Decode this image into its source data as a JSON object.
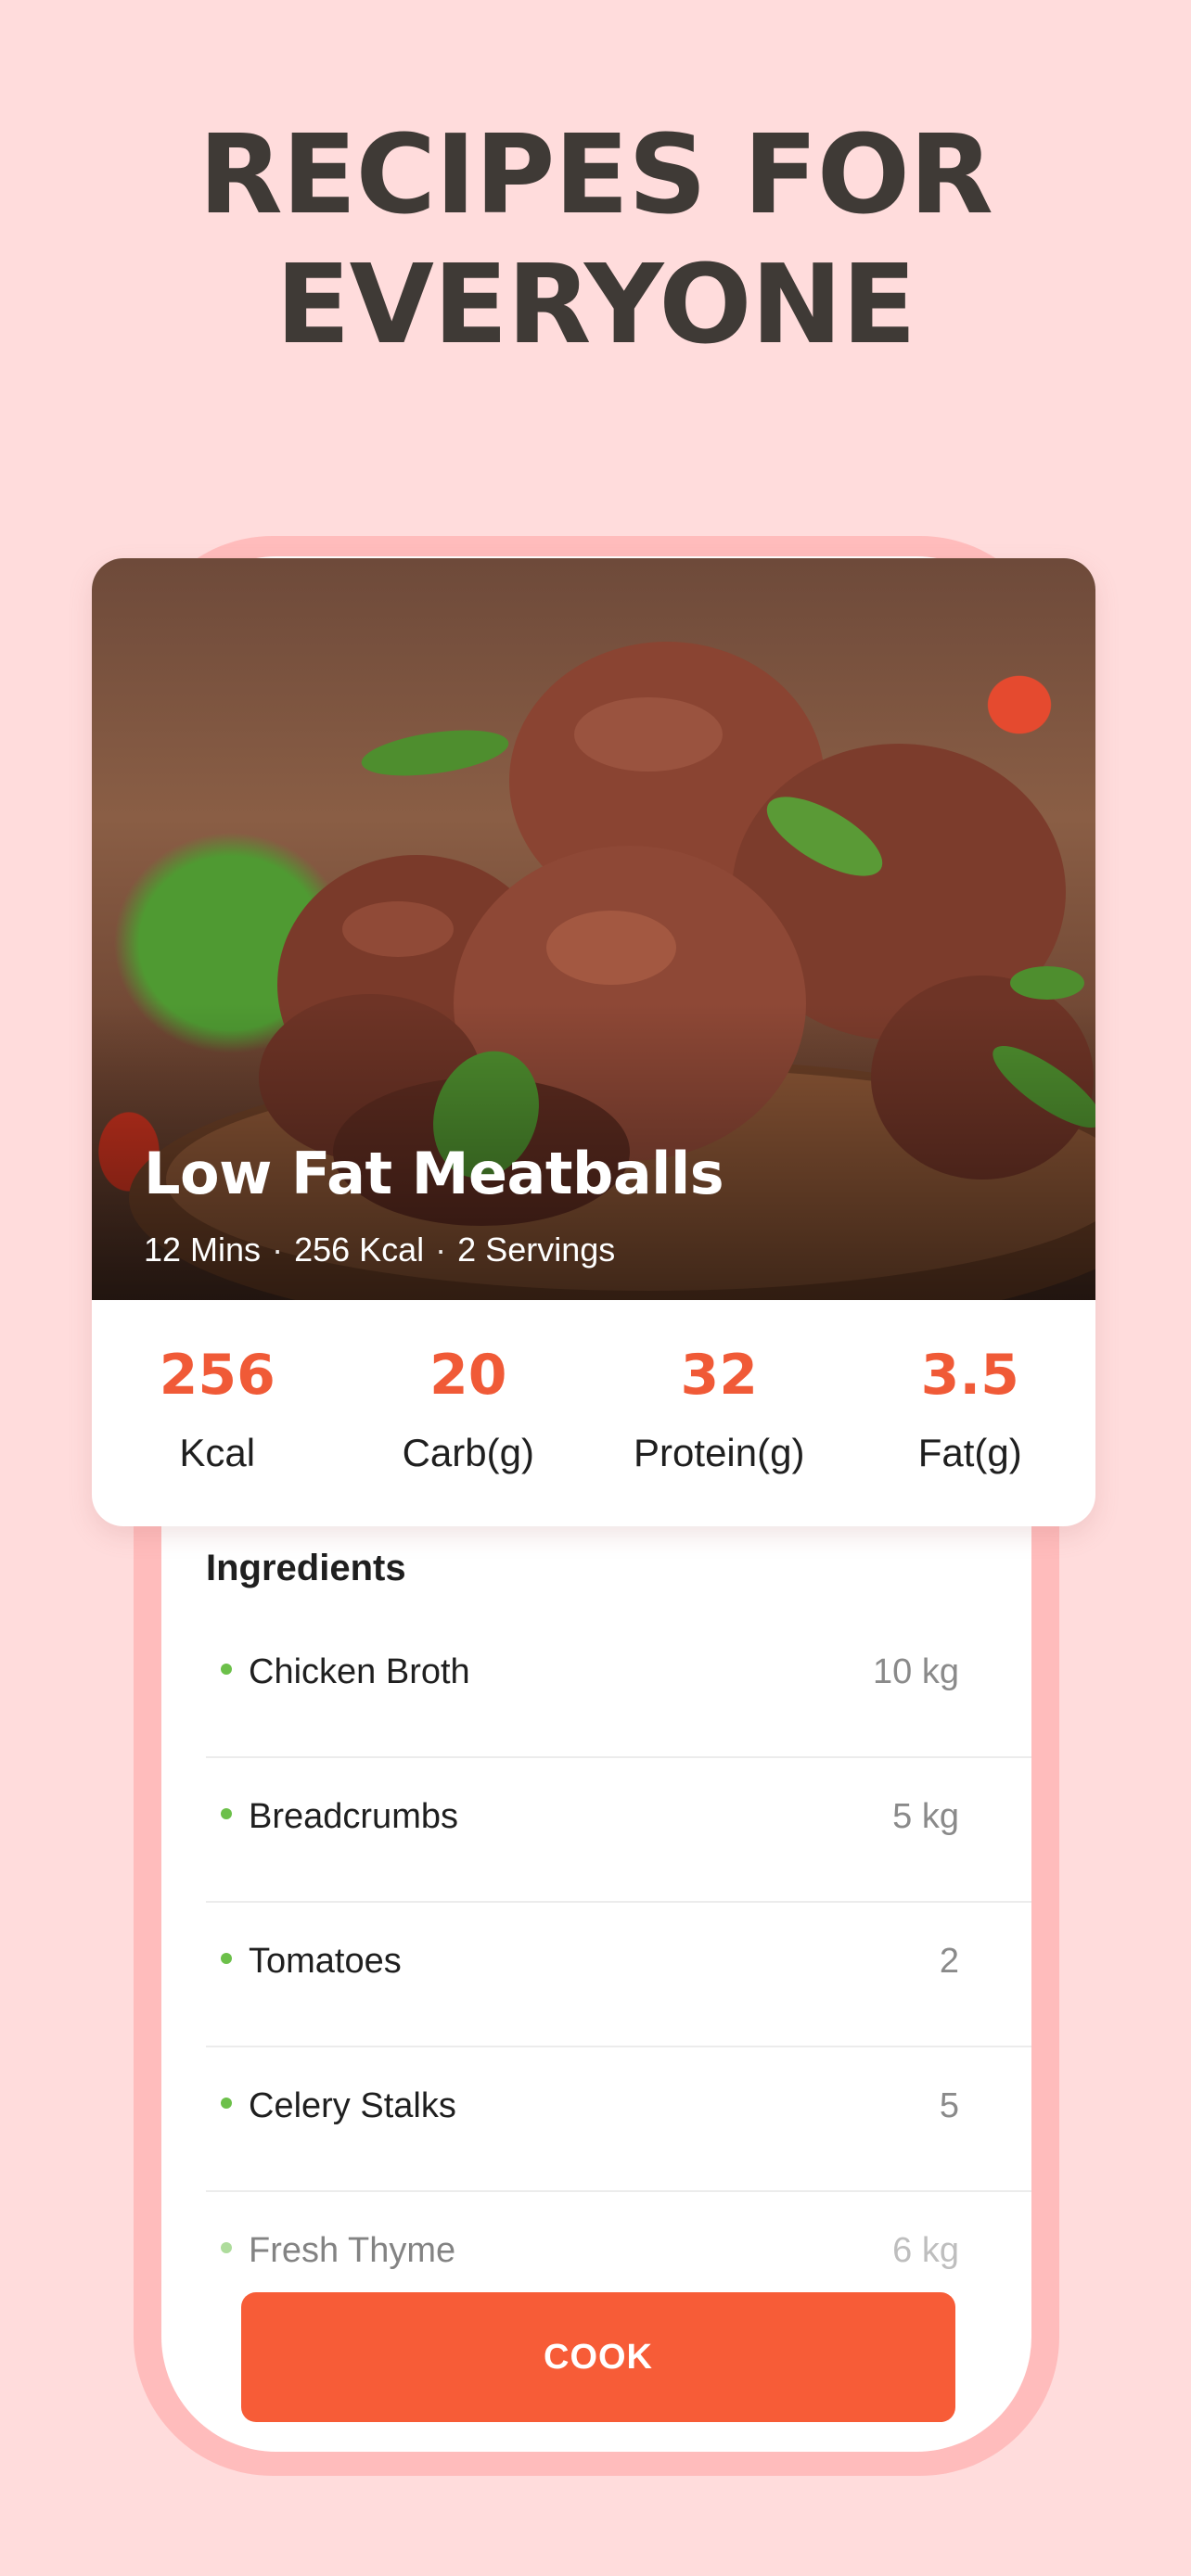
{
  "headline": {
    "line1": "RECIPES FOR",
    "line2": "EVERYONE"
  },
  "recipe": {
    "title": "Low Fat Meatballs",
    "time": "12 Mins",
    "separator1": "·",
    "calories": "256 Kcal",
    "separator2": "·",
    "servings": "2 Servings",
    "image_icon": "meatballs-photo"
  },
  "nutrition": [
    {
      "value": "256",
      "label": "Kcal"
    },
    {
      "value": "20",
      "label": "Carb(g)"
    },
    {
      "value": "32",
      "label": "Protein(g)"
    },
    {
      "value": "3.5",
      "label": "Fat(g)"
    }
  ],
  "ingredients": {
    "title": "Ingredients",
    "items": [
      {
        "name": "Chicken Broth",
        "qty": "10 kg"
      },
      {
        "name": "Breadcrumbs",
        "qty": "5 kg"
      },
      {
        "name": "Tomatoes",
        "qty": "2"
      },
      {
        "name": "Celery Stalks",
        "qty": "5"
      },
      {
        "name": "Fresh Thyme",
        "qty": "6 kg"
      }
    ]
  },
  "cook_button": {
    "label": "COOK"
  },
  "colors": {
    "background": "#ffdcdc",
    "frame": "#ffbcbc",
    "accent": "#f75c37",
    "bullet": "#6cc04a",
    "heading": "#3f3a36"
  }
}
